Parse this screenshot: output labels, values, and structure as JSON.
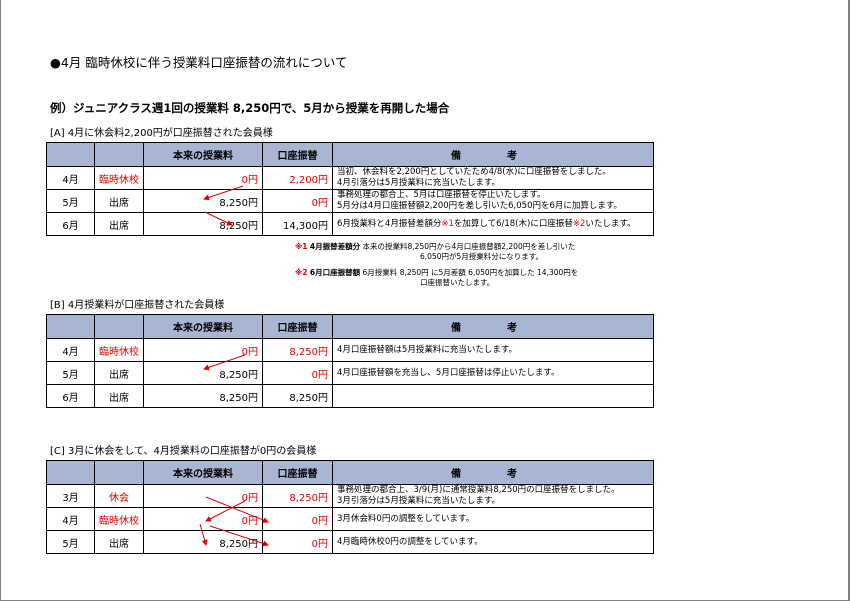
{
  "title": "●4月 臨時休校に伴う授業料口座振替の流れについて",
  "example": "例）ジュニアクラス週1回の授業料 8,250円で、5月から授業を再開した場合",
  "headers": {
    "fee": "本来の授業料",
    "transfer": "口座振替",
    "note": "備　考"
  },
  "sectionA": {
    "label": "[A]  4月に休会料2,200円が口座振替された会員様",
    "rows": [
      {
        "month": "4月",
        "status": "臨時休校",
        "fee": "0円",
        "transfer": "2,200円",
        "note": "当初、休会料を2,200円としていたため4/8(水)に口座振替をしました。\n4月引落分は5月授業料に充当いたします。"
      },
      {
        "month": "5月",
        "status": "出席",
        "fee": "8,250円",
        "transfer": "0円",
        "note": "事務処理の都合上、5月は口座振替を停止いたします。\n5月分は4月口座振替額2,200円を差し引いた6,050円を6月に加算します。"
      },
      {
        "month": "6月",
        "status": "出席",
        "fee": "8,250円",
        "transfer": "14,300円",
        "note_pre": "6月授業料と4月振替差額分",
        "note_mark1": "※1",
        "note_mid": "を加算して6/18(木)に口座振替",
        "note_mark2": "※2",
        "note_post": "いたします。"
      }
    ],
    "footnotes": [
      {
        "mark": "※1",
        "label": "4月振替差額分",
        "line1": "本来の授業料8,250円から4月口座振替額2,200円を差し引いた",
        "line2": "6,050円が5月授業料分になります。"
      },
      {
        "mark": "※2",
        "label": "6月口座振替額",
        "line1": "6月授業料 8,250円 に5月差額 6,050円を加算した 14,300円を",
        "line2": "口座振替いたします。"
      }
    ]
  },
  "sectionB": {
    "label": "[B]  4月授業料が口座振替された会員様",
    "rows": [
      {
        "month": "4月",
        "status": "臨時休校",
        "fee": "0円",
        "transfer": "8,250円",
        "note": "4月口座振替額は5月授業料に充当いたします。"
      },
      {
        "month": "5月",
        "status": "出席",
        "fee": "8,250円",
        "transfer": "0円",
        "note": "4月口座振替額を充当し、5月口座振替は停止いたします。"
      },
      {
        "month": "6月",
        "status": "出席",
        "fee": "8,250円",
        "transfer": "8,250円",
        "note": ""
      }
    ]
  },
  "sectionC": {
    "label": "[C]  3月に休会をして、4月授業料の口座振替が0円の会員様",
    "rows": [
      {
        "month": "3月",
        "status": "休会",
        "fee": "0円",
        "transfer": "8,250円",
        "note": "事務処理の都合上、3/9(月)に通常授業料8,250円の口座振替をしました。\n3月引落分は5月授業料に充当いたします。"
      },
      {
        "month": "4月",
        "status": "臨時休校",
        "fee": "0円",
        "transfer": "0円",
        "note": "3月休会料0円の調整をしています。"
      },
      {
        "month": "5月",
        "status": "出席",
        "fee": "8,250円",
        "transfer": "0円",
        "note": "4月臨時休校0円の調整をしています。"
      }
    ]
  },
  "colors": {
    "header_bg": "#a9b6d3",
    "accent_red": "#e00000"
  }
}
